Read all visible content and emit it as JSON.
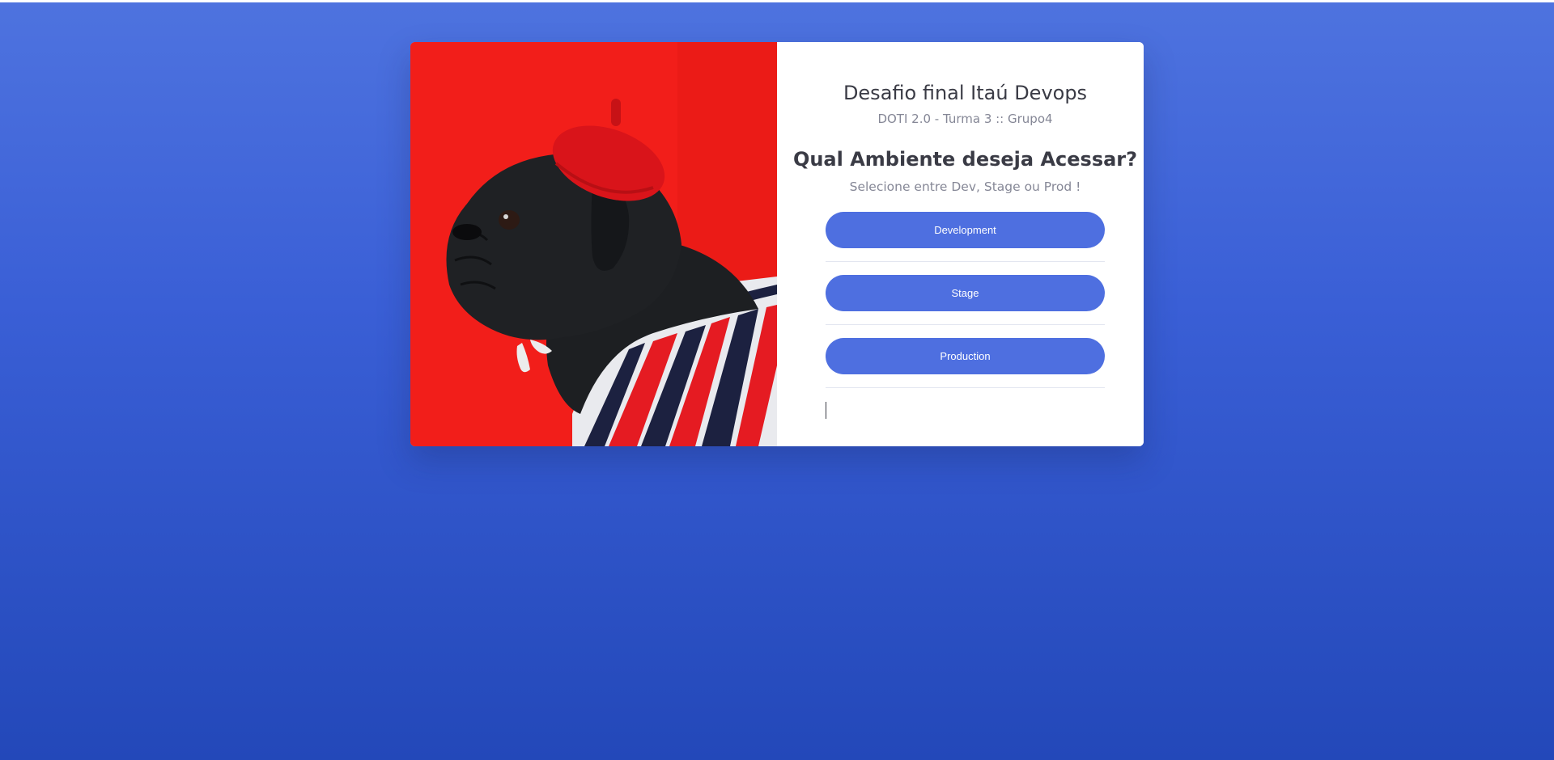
{
  "page": {
    "background_top": "#4e73df",
    "background_bottom": "#2348b9"
  },
  "card": {
    "image": {
      "alt": "Pug wearing a red beret and striped sweater against a red background",
      "colors": {
        "background": "#f21e1a",
        "beret": "#d9141a",
        "fur": "#1d1f22",
        "stripe_navy": "#1c2140",
        "stripe_white": "#e9eaee"
      }
    },
    "header": {
      "title": "Desafio final Itaú Devops",
      "subtitle": "DOTI 2.0 - Turma 3 :: Grupo4"
    },
    "prompt": {
      "question": "Qual Ambiente deseja Acessar?",
      "hint": "Selecione entre Dev, Stage ou Prod !"
    },
    "environments": [
      {
        "label": "Development"
      },
      {
        "label": "Stage"
      },
      {
        "label": "Production"
      }
    ],
    "accent_color": "#4e6fe0"
  }
}
